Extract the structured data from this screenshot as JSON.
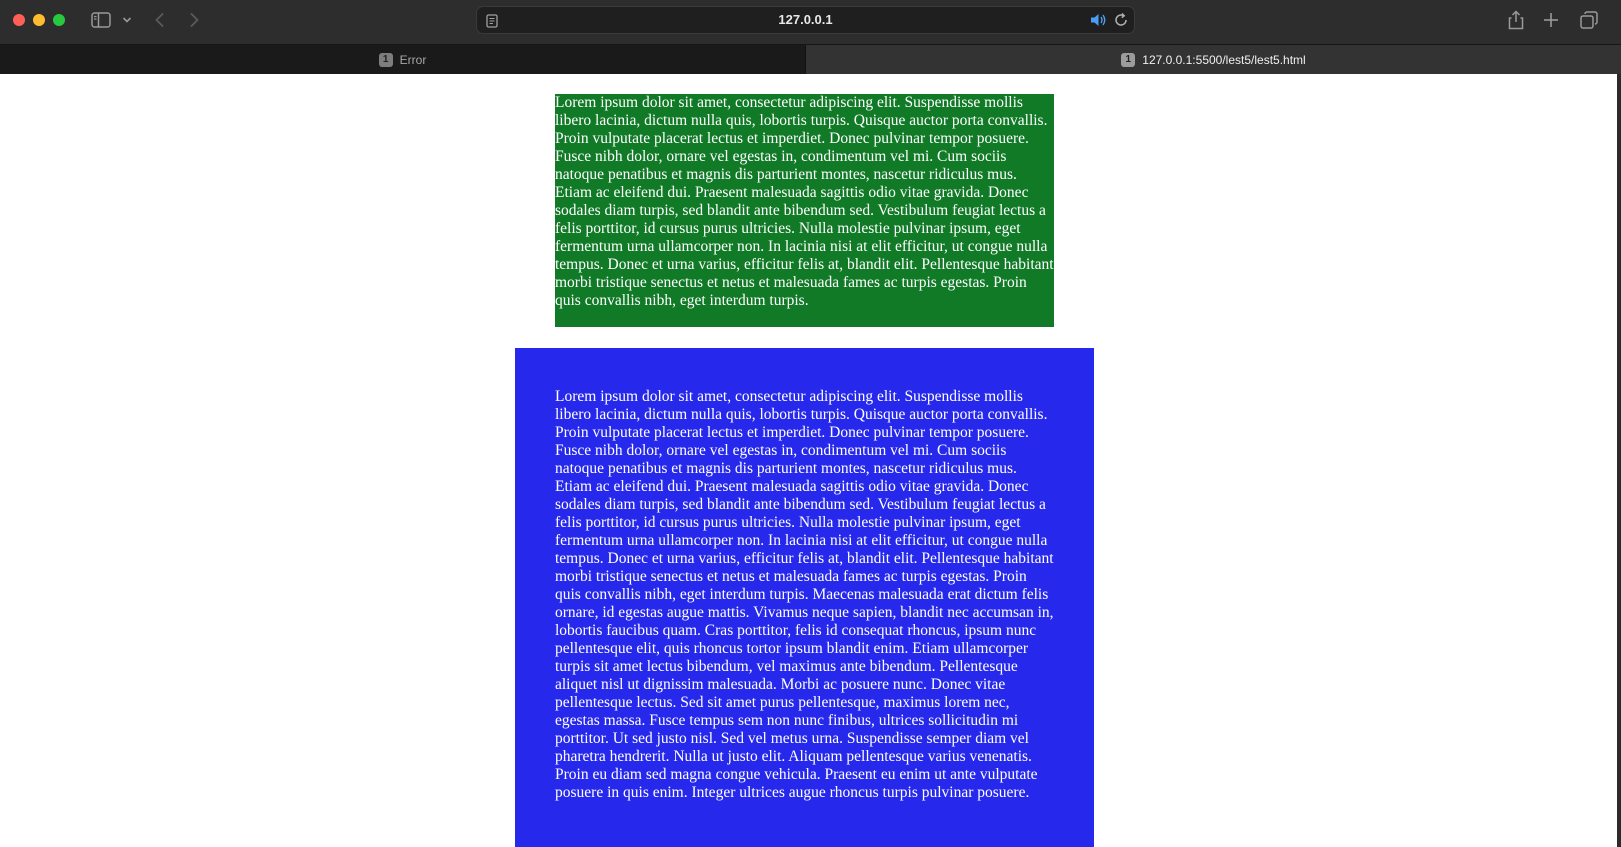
{
  "browser": {
    "address_bar": {
      "url": "127.0.0.1"
    },
    "tabs": [
      {
        "badge": "1",
        "label": "Error",
        "active": false
      },
      {
        "badge": "1",
        "label": "127.0.0.1:5500/lest5/lest5.html",
        "active": true
      }
    ],
    "icons": {
      "sidebar": "sidebar-icon",
      "chevron": "chevron-down-icon",
      "back": "back-arrow-icon",
      "forward": "forward-arrow-icon",
      "page": "page-icon",
      "speaker": "speaker-icon",
      "reload": "reload-icon",
      "share": "share-icon",
      "new_tab": "plus-icon",
      "tab_overview": "tab-overview-icon"
    }
  },
  "page": {
    "green_block": {
      "text": "Lorem ipsum dolor sit amet, consectetur adipiscing elit. Suspendisse mollis libero lacinia, dictum nulla quis, lobortis turpis. Quisque auctor porta convallis. Proin vulputate placerat lectus et imperdiet. Donec pulvinar tempor posuere. Fusce nibh dolor, ornare vel egestas in, condimentum vel mi. Cum sociis natoque penatibus et magnis dis parturient montes, nascetur ridiculus mus. Etiam ac eleifend dui. Praesent malesuada sagittis odio vitae gravida. Donec sodales diam turpis, sed blandit ante bibendum sed. Vestibulum feugiat lectus a felis porttitor, id cursus purus ultricies. Nulla molestie pulvinar ipsum, eget fermentum urna ullamcorper non. In lacinia nisi at elit efficitur, ut congue nulla tempus. Donec et urna varius, efficitur felis at, blandit elit. Pellentesque habitant morbi tristique senectus et netus et malesuada fames ac turpis egestas. Proin quis convallis nibh, eget interdum turpis.",
      "background": "#117a27"
    },
    "blue_block": {
      "text": "Lorem ipsum dolor sit amet, consectetur adipiscing elit. Suspendisse mollis libero lacinia, dictum nulla quis, lobortis turpis. Quisque auctor porta convallis. Proin vulputate placerat lectus et imperdiet. Donec pulvinar tempor posuere. Fusce nibh dolor, ornare vel egestas in, condimentum vel mi. Cum sociis natoque penatibus et magnis dis parturient montes, nascetur ridiculus mus. Etiam ac eleifend dui. Praesent malesuada sagittis odio vitae gravida. Donec sodales diam turpis, sed blandit ante bibendum sed. Vestibulum feugiat lectus a felis porttitor, id cursus purus ultricies. Nulla molestie pulvinar ipsum, eget fermentum urna ullamcorper non. In lacinia nisi at elit efficitur, ut congue nulla tempus. Donec et urna varius, efficitur felis at, blandit elit. Pellentesque habitant morbi tristique senectus et netus et malesuada fames ac turpis egestas. Proin quis convallis nibh, eget interdum turpis. Maecenas malesuada erat dictum felis ornare, id egestas augue mattis. Vivamus neque sapien, blandit nec accumsan in, lobortis faucibus quam. Cras porttitor, felis id consequat rhoncus, ipsum nunc pellentesque elit, quis rhoncus tortor ipsum blandit enim. Etiam ullamcorper turpis sit amet lectus bibendum, vel maximus ante bibendum. Pellentesque aliquet nisl ut dignissim malesuada. Morbi ac posuere nunc. Donec vitae pellentesque lectus. Sed sit amet purus pellentesque, maximus lorem nec, egestas massa. Fusce tempus sem non nunc finibus, ultrices sollicitudin mi porttitor. Ut sed justo nisl. Sed vel metus urna. Suspendisse semper diam vel pharetra hendrerit. Nulla ut justo elit. Aliquam pellentesque varius venenatis. Proin eu diam sed magna congue vehicula. Praesent eu enim ut ante vulputate posuere in quis enim. Integer ultrices augue rhoncus turpis pulvinar posuere.",
      "background": "#2629ec"
    }
  }
}
